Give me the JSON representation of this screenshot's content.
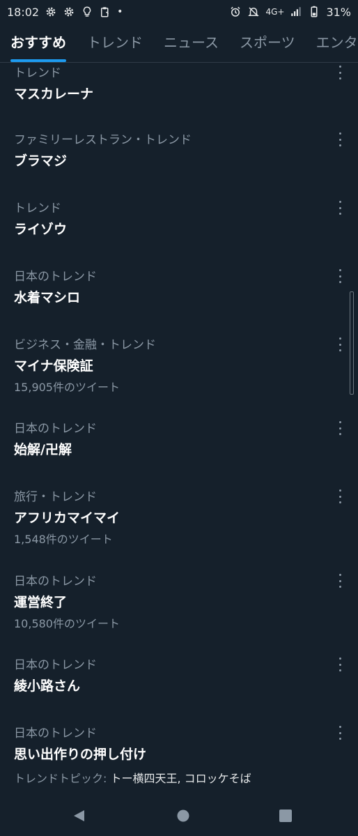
{
  "status_bar": {
    "time": "18:02",
    "dot": "•",
    "network": "4G+",
    "battery": "31%"
  },
  "tabs": [
    {
      "label": "おすすめ"
    },
    {
      "label": "トレンド"
    },
    {
      "label": "ニュース"
    },
    {
      "label": "スポーツ"
    },
    {
      "label": "エンタ"
    }
  ],
  "trends": [
    {
      "context": "トレンド",
      "name": "マスカレーナ"
    },
    {
      "context": "ファミリーレストラン・トレンド",
      "name": "ブラマジ"
    },
    {
      "context": "トレンド",
      "name": "ライゾウ"
    },
    {
      "context": "日本のトレンド",
      "name": "水着マシロ"
    },
    {
      "context": "ビジネス・金融・トレンド",
      "name": "マイナ保険証",
      "count": "15,905件のツイート"
    },
    {
      "context": "日本のトレンド",
      "name": "始解/卍解"
    },
    {
      "context": "旅行・トレンド",
      "name": "アフリカマイマイ",
      "count": "1,548件のツイート"
    },
    {
      "context": "日本のトレンド",
      "name": "運営終了",
      "count": "10,580件のツイート"
    },
    {
      "context": "日本のトレンド",
      "name": "綾小路さん"
    },
    {
      "context": "日本のトレンド",
      "name": "思い出作りの押し付け",
      "topic_label": "トレンドトピック:",
      "topic_value": "トー横四天王, コロッケそば"
    }
  ],
  "icons": {
    "status_left": [
      "gear-icon",
      "gear-icon",
      "lightbulb-icon",
      "clipboard-icon"
    ],
    "status_right": [
      "alarm-icon",
      "bell-off-icon",
      "signal-icon",
      "battery-icon"
    ],
    "more": "more-vertical-icon",
    "nav": [
      "back-icon",
      "home-icon",
      "recents-icon"
    ]
  },
  "colors": {
    "background": "#15202b",
    "accent": "#1d9bf0",
    "secondary_text": "#8b98a5",
    "primary_text": "#ffffff"
  }
}
